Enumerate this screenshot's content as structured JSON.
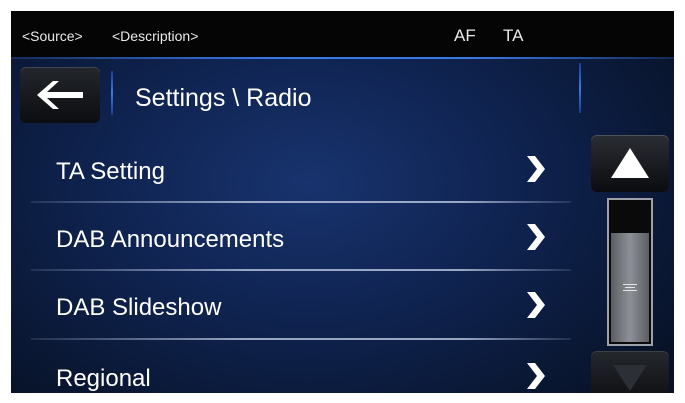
{
  "status_bar": {
    "source": "<Source>",
    "description": "<Description>",
    "af": "AF",
    "ta": "TA"
  },
  "header": {
    "title": "Settings \\ Radio",
    "back_icon": "back-arrow-icon"
  },
  "menu": {
    "items": [
      {
        "label": "TA Setting"
      },
      {
        "label": "DAB Announcements"
      },
      {
        "label": "DAB Slideshow"
      },
      {
        "label": "Regional"
      }
    ]
  },
  "scrollbar": {
    "up_icon": "triangle-up-icon",
    "down_icon": "triangle-down-icon",
    "thumb_start_fraction": 0.23,
    "thumb_size_fraction": 0.77
  },
  "colors": {
    "accent": "#3b78e6",
    "background": "#0f2350",
    "text": "#ffffff"
  }
}
